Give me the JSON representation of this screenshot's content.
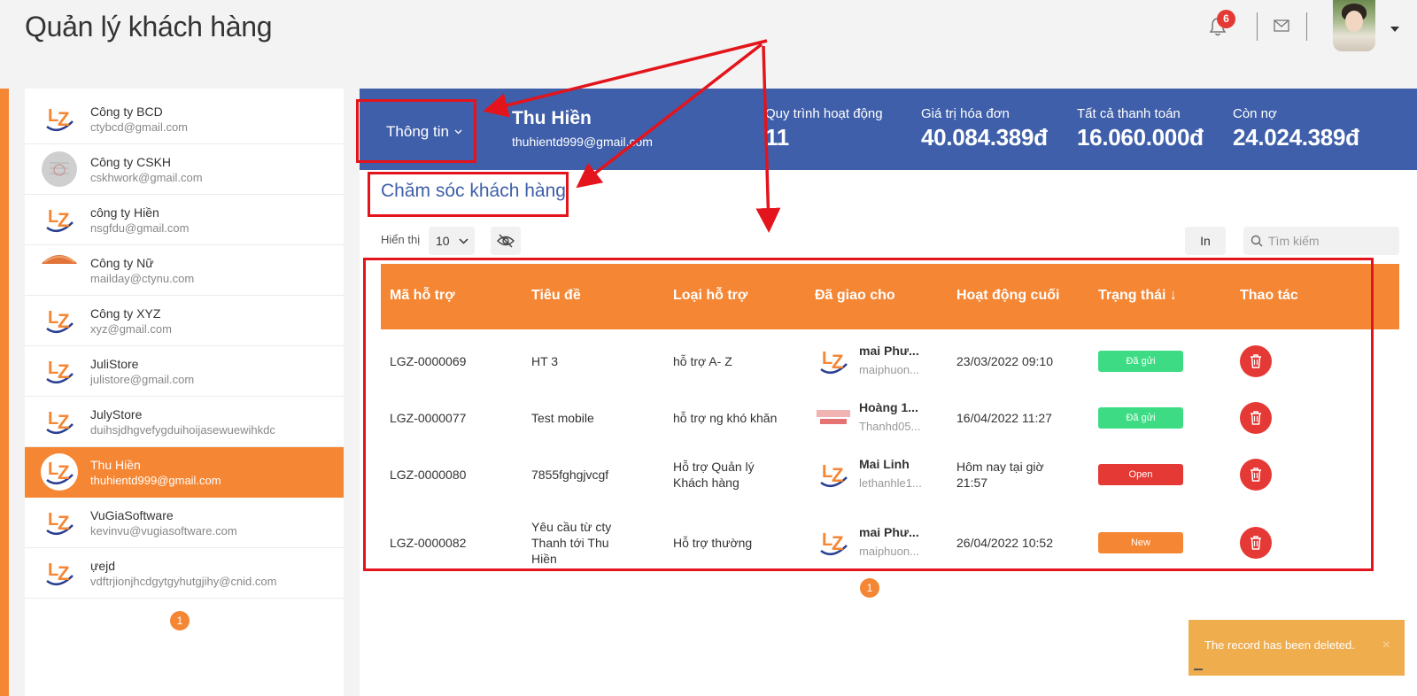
{
  "header": {
    "title": "Quản lý khách hàng",
    "notification_count": "6",
    "icons": [
      "bell-icon",
      "mail-icon",
      "avatar",
      "chevron-down-icon"
    ]
  },
  "sidebar": {
    "customers": [
      {
        "name": "Công ty BCD",
        "email": "ctybcd@gmail.com",
        "logo": "lz-logo"
      },
      {
        "name": "Công ty CSKH",
        "email": "cskhwork@gmail.com",
        "logo": "sketch-logo"
      },
      {
        "name": "công ty Hiền",
        "email": "nsgfdu@gmail.com",
        "logo": "lz-logo"
      },
      {
        "name": "Công ty Nữ",
        "email": "mailday@ctynu.com",
        "logo": "sunset-logo"
      },
      {
        "name": "Công ty XYZ",
        "email": "xyz@gmail.com",
        "logo": "lz-logo"
      },
      {
        "name": "JuliStore",
        "email": "julistore@gmail.com",
        "logo": "lz-logo"
      },
      {
        "name": "JulyStore",
        "email": "duihsjdhgvefygduihoijasewuewihkdc",
        "logo": "lz-logo"
      },
      {
        "name": "Thu Hiền",
        "email": "thuhientd999@gmail.com",
        "logo": "lz-logo",
        "active": true
      },
      {
        "name": "VuGiaSoftware",
        "email": "kevinvu@vugiasoftware.com",
        "logo": "lz-logo"
      },
      {
        "name": "ựejd",
        "email": "vdftrjionjhcdgytgyhutgjihy@cnid.com",
        "logo": "lz-logo"
      }
    ],
    "page": "1"
  },
  "profile": {
    "info_button": "Thông tin",
    "name": "Thu Hiền",
    "email": "thuhientd999@gmail.com",
    "stats": [
      {
        "label": "Quy trình hoạt động",
        "value": "11"
      },
      {
        "label": "Giá trị hóa đơn",
        "value": "40.084.389đ"
      },
      {
        "label": "Tất cả thanh toán",
        "value": "16.060.000đ"
      },
      {
        "label": "Còn nợ",
        "value": "24.024.389đ"
      }
    ]
  },
  "section": {
    "title": "Chăm sóc khách hàng",
    "show_label": "Hiển thị",
    "page_size": "10",
    "print_label": "In",
    "search_placeholder": "Tìm kiếm"
  },
  "table": {
    "columns": [
      "Mã hỗ trợ",
      "Tiêu đề",
      "Loại hỗ trợ",
      "Đã giao cho",
      "Hoạt động cuối",
      "Trạng thái ↓",
      "Thao tác"
    ],
    "rows": [
      {
        "id": "LGZ-0000069",
        "title": "HT 3",
        "type": "hỗ trợ A- Z",
        "assignee": "mai Phư...",
        "assignee_email": "maiphuon...",
        "last_activity": "23/03/2022 09:10",
        "status": "Đã gửi",
        "status_color": "#3ddc84"
      },
      {
        "id": "LGZ-0000077",
        "title": "Test mobile",
        "type": "hỗ trợ ng khó khăn",
        "assignee": "Hoàng 1...",
        "assignee_email": "Thanhd05...",
        "last_activity": "16/04/2022 11:27",
        "status": "Đã gửi",
        "status_color": "#3ddc84"
      },
      {
        "id": "LGZ-0000080",
        "title": "7855fghgjvcgf",
        "type": "Hỗ trợ Quản lý Khách hàng",
        "assignee": "Mai Linh",
        "assignee_email": "lethanhle1...",
        "last_activity": "Hôm nay tại giờ 21:57",
        "status": "Open",
        "status_color": "#e53935"
      },
      {
        "id": "LGZ-0000082",
        "title": "Yêu cầu từ cty Thanh tới Thu Hiền",
        "type": "Hỗ trợ thường",
        "assignee": "mai Phư...",
        "assignee_email": "maiphuon...",
        "last_activity": "26/04/2022 10:52",
        "status": "New",
        "status_color": "#f58634"
      }
    ],
    "page": "1"
  },
  "toast": {
    "message": "The record has been deleted.",
    "close": "×"
  },
  "colors": {
    "accent": "#f58634",
    "primary": "#3f5faa",
    "annotation": "#e3141b"
  }
}
